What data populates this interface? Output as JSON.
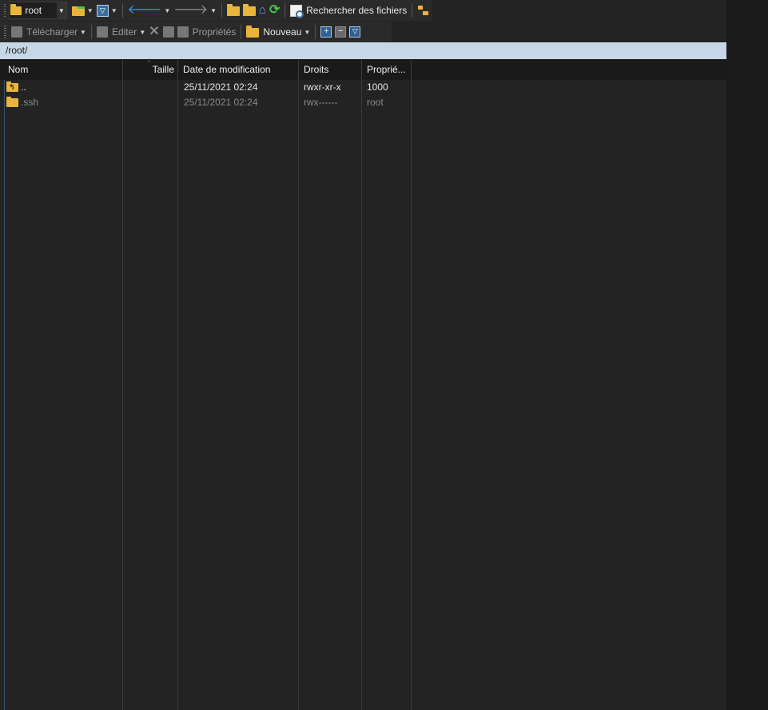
{
  "toolbar1": {
    "location": "root",
    "search_label": "Rechercher des fichiers"
  },
  "toolbar2": {
    "download_label": "Télécharger",
    "edit_label": "Editer",
    "properties_label": "Propriétés",
    "new_label": "Nouveau"
  },
  "path": "/root/",
  "columns": {
    "name": "Nom",
    "size": "Taille",
    "modified": "Date de modification",
    "rights": "Droits",
    "owner": "Proprié..."
  },
  "files": [
    {
      "name": "..",
      "size": "",
      "modified": "25/11/2021 02:24",
      "rights": "rwxr-xr-x",
      "owner": "1000",
      "icon": "parent-folder-icon"
    },
    {
      "name": ".ssh",
      "size": "",
      "modified": "25/11/2021 02:24",
      "rights": "rwx------",
      "owner": "root",
      "icon": "folder-icon"
    }
  ],
  "colors": {
    "path_bar": "#c6d7e7",
    "folder": "#e9b43a",
    "background": "#232323"
  }
}
